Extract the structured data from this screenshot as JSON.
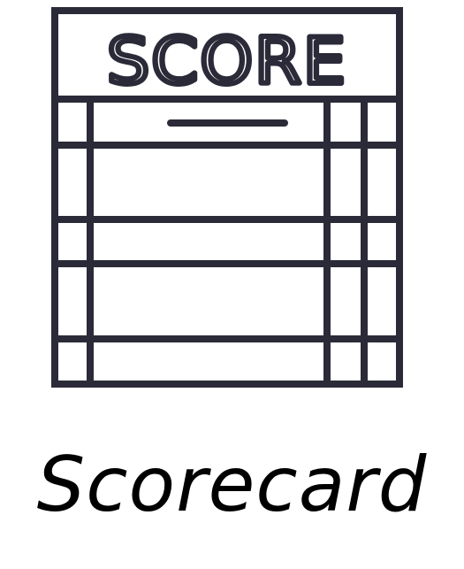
{
  "icon": {
    "name": "scorecard-icon",
    "header_text": "SCORE",
    "stroke_color": "#2b2a38"
  },
  "caption": "Scorecard"
}
